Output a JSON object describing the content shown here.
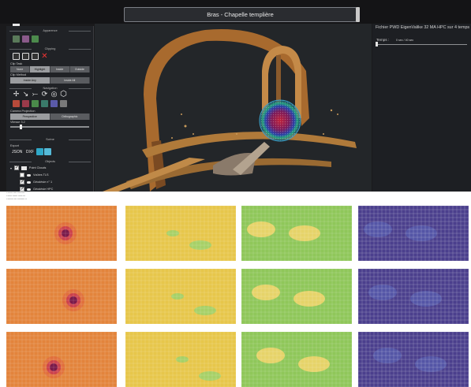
{
  "viewer": {
    "title": "Bras - Chapelle templière",
    "info_heading": "Fichier PWD EigenValike 32 MA HPC sur 4 temps",
    "time_label": "Temps :",
    "time_value": "0 sec / 40 sec"
  },
  "sidebar": {
    "sections": {
      "appearance": "Apparence",
      "clipping": "Clipping",
      "navigation": "Navigation",
      "scene": "Scène",
      "objects": "Objects"
    },
    "labels": {
      "clip_task": "Clip Task",
      "clip_method": "Clip Method",
      "camera_projection": "Camera Projection",
      "speed": "Vitesse",
      "speed_value": "3.2",
      "export": "Export"
    },
    "clip_tasks": [
      "None",
      "Highlight",
      "Inside",
      "Outside"
    ],
    "clip_methods": [
      "Inside Any",
      "Inside All"
    ],
    "projections": [
      "Perspective",
      "Orthographic"
    ],
    "export_buttons": [
      "JSON",
      "DXF"
    ],
    "tree": {
      "root": "Point Clouds",
      "items": [
        {
          "label": "Voûtes TLS",
          "checked": false
        },
        {
          "label": "Géodésie n° 1",
          "checked": true
        },
        {
          "label": "Géodésie HPC",
          "checked": true
        }
      ]
    },
    "panel_toggle": "☰"
  },
  "colors": {
    "viewer_bg": "#1a1a1c",
    "accent_orange": "#e59a3e",
    "accent_yellow": "#e7c64b",
    "accent_green": "#8fc75a",
    "accent_purple": "#4b3f8d"
  }
}
